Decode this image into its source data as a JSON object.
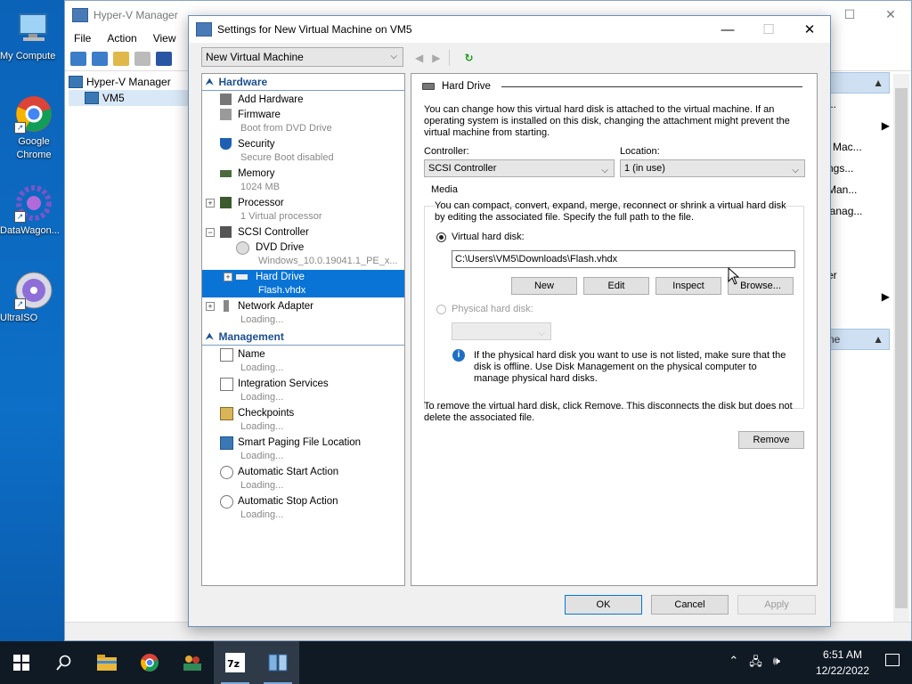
{
  "desktop": {
    "icons": [
      {
        "label": "My Compute"
      },
      {
        "label": "Google Chrome"
      },
      {
        "label": "DataWagon..."
      },
      {
        "label": "UltraISO"
      }
    ]
  },
  "hyperv": {
    "title": "Hyper-V Manager",
    "menu": [
      "File",
      "Action",
      "View",
      "H"
    ],
    "tree": [
      "Hyper-V Manager",
      "VM5"
    ],
    "actions_rows": [
      "...",
      "",
      "l Mac...",
      "ngs...",
      "Man...",
      "lanag...",
      "",
      "er",
      "",
      "",
      "ne"
    ]
  },
  "dialog": {
    "title": "Settings for New Virtual Machine on VM5",
    "vm_select": "New Virtual Machine",
    "hardware_header": "Hardware",
    "management_header": "Management",
    "hardware_items": {
      "add_hardware": "Add Hardware",
      "firmware": "Firmware",
      "firmware_sub": "Boot from DVD Drive",
      "security": "Security",
      "security_sub": "Secure Boot disabled",
      "memory": "Memory",
      "memory_sub": "1024 MB",
      "processor": "Processor",
      "processor_sub": "1 Virtual processor",
      "scsi": "SCSI Controller",
      "dvd": "DVD Drive",
      "dvd_sub": "Windows_10.0.19041.1_PE_x...",
      "hdd": "Hard Drive",
      "hdd_sub": "Flash.vhdx",
      "network": "Network Adapter",
      "network_sub": "Loading..."
    },
    "management_items": {
      "name": "Name",
      "name_sub": "Loading...",
      "integration": "Integration Services",
      "integration_sub": "Loading...",
      "checkpoints": "Checkpoints",
      "checkpoints_sub": "Loading...",
      "paging": "Smart Paging File Location",
      "paging_sub": "Loading...",
      "start": "Automatic Start Action",
      "start_sub": "Loading...",
      "stop": "Automatic Stop Action",
      "stop_sub": "Loading..."
    },
    "panel": {
      "heading": "Hard Drive",
      "intro": "You can change how this virtual hard disk is attached to the virtual machine. If an operating system is installed on this disk, changing the attachment might prevent the virtual machine from starting.",
      "controller_label": "Controller:",
      "controller_value": "SCSI Controller",
      "location_label": "Location:",
      "location_value": "1 (in use)",
      "media_label": "Media",
      "media_desc": "You can compact, convert, expand, merge, reconnect or shrink a virtual hard disk by editing the associated file. Specify the full path to the file.",
      "vhd_label": "Virtual hard disk:",
      "vhd_path": "C:\\Users\\VM5\\Downloads\\Flash.vhdx",
      "btn_new": "New",
      "btn_edit": "Edit",
      "btn_inspect": "Inspect",
      "btn_browse": "Browse...",
      "phys_label": "Physical hard disk:",
      "phys_info": "If the physical hard disk you want to use is not listed, make sure that the disk is offline. Use Disk Management on the physical computer to manage physical hard disks.",
      "remove_text": "To remove the virtual hard disk, click Remove. This disconnects the disk but does not delete the associated file.",
      "btn_remove": "Remove"
    },
    "buttons": {
      "ok": "OK",
      "cancel": "Cancel",
      "apply": "Apply"
    }
  },
  "taskbar": {
    "time": "6:51 AM",
    "date": "12/22/2022"
  },
  "colors": {
    "accent": "#0a74d6",
    "header_blue": "#1c4f8f",
    "taskbar": "#101a24"
  }
}
